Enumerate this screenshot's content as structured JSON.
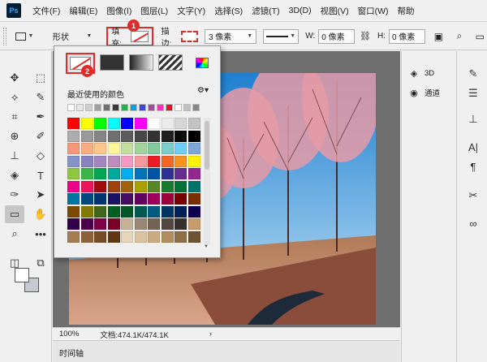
{
  "menu": [
    "文件(F)",
    "编辑(E)",
    "图像(I)",
    "图层(L)",
    "文字(Y)",
    "选择(S)",
    "滤镜(T)",
    "3D(D)",
    "视图(V)",
    "窗口(W)",
    "帮助"
  ],
  "logo_text": "Ps",
  "options": {
    "mode_label": "形状",
    "fill_label": "填充:",
    "stroke_label": "描边:",
    "stroke_width": "3 像素",
    "w_label": "W:",
    "w_value": "0 像素",
    "h_label": "H:",
    "h_value": "0 像素"
  },
  "badges": {
    "one": "1",
    "two": "2"
  },
  "popup": {
    "recent_label": "最近使用的颜色",
    "recent_colors": [
      "#ffffff",
      "#e6e6e6",
      "#cfcfcf",
      "#a0a0a0",
      "#707070",
      "#3a3a3a",
      "#22b14c",
      "#00a2e8",
      "#3f48cc",
      "#a349a4",
      "#ff2fbd",
      "#e81123",
      "#ffffff",
      "#bfbfbf",
      "#888888"
    ],
    "grid_colors": [
      "#ff0000",
      "#ffff00",
      "#00ff00",
      "#00ffff",
      "#0000ff",
      "#ff00ff",
      "#ffffff",
      "#ebebeb",
      "#d6d6d6",
      "#c2c2c2",
      "#adadad",
      "#999999",
      "#858585",
      "#707070",
      "#5c5c5c",
      "#474747",
      "#333333",
      "#1f1f1f",
      "#0a0a0a",
      "#000000",
      "#f7977a",
      "#f9ad81",
      "#fdc68a",
      "#fff79a",
      "#c4df9b",
      "#a3d39c",
      "#82ca9d",
      "#7bcdc8",
      "#6ecff6",
      "#7ea7d8",
      "#8493ca",
      "#8882be",
      "#a187be",
      "#bc8dbf",
      "#f49ac2",
      "#f6989d",
      "#ed1c24",
      "#f26522",
      "#f7941d",
      "#fff200",
      "#8dc63f",
      "#39b54a",
      "#00a651",
      "#00a99d",
      "#00aeef",
      "#0072bc",
      "#0054a6",
      "#2e3192",
      "#662d91",
      "#92278f",
      "#ec008c",
      "#ed145b",
      "#9e0b0f",
      "#a0410d",
      "#a36209",
      "#aba000",
      "#598527",
      "#197b30",
      "#007236",
      "#00746b",
      "#0076a3",
      "#004a80",
      "#003471",
      "#1b1464",
      "#440e62",
      "#630460",
      "#9e005d",
      "#9e0039",
      "#790000",
      "#7b2e00",
      "#7d4900",
      "#827b00",
      "#406618",
      "#005e20",
      "#005826",
      "#005952",
      "#005b7f",
      "#003663",
      "#002157",
      "#0d004c",
      "#32004b",
      "#4b0049",
      "#7b0046",
      "#7a0026",
      "#c7b299",
      "#998675",
      "#736357",
      "#534741",
      "#37302d",
      "#c69c6d",
      "#a67c52",
      "#8c6239",
      "#754c24",
      "#603913",
      "#e6d5b8",
      "#d9c3a0",
      "#c9ab80",
      "#b08e5e",
      "#8e6f45",
      "#6e5433"
    ]
  },
  "panels": {
    "entries": [
      "3D",
      "通道"
    ]
  },
  "status": {
    "zoom": "100%",
    "doc_info": "文档:474.1K/474.1K",
    "arrow": "›"
  },
  "timeline": "时间轴"
}
